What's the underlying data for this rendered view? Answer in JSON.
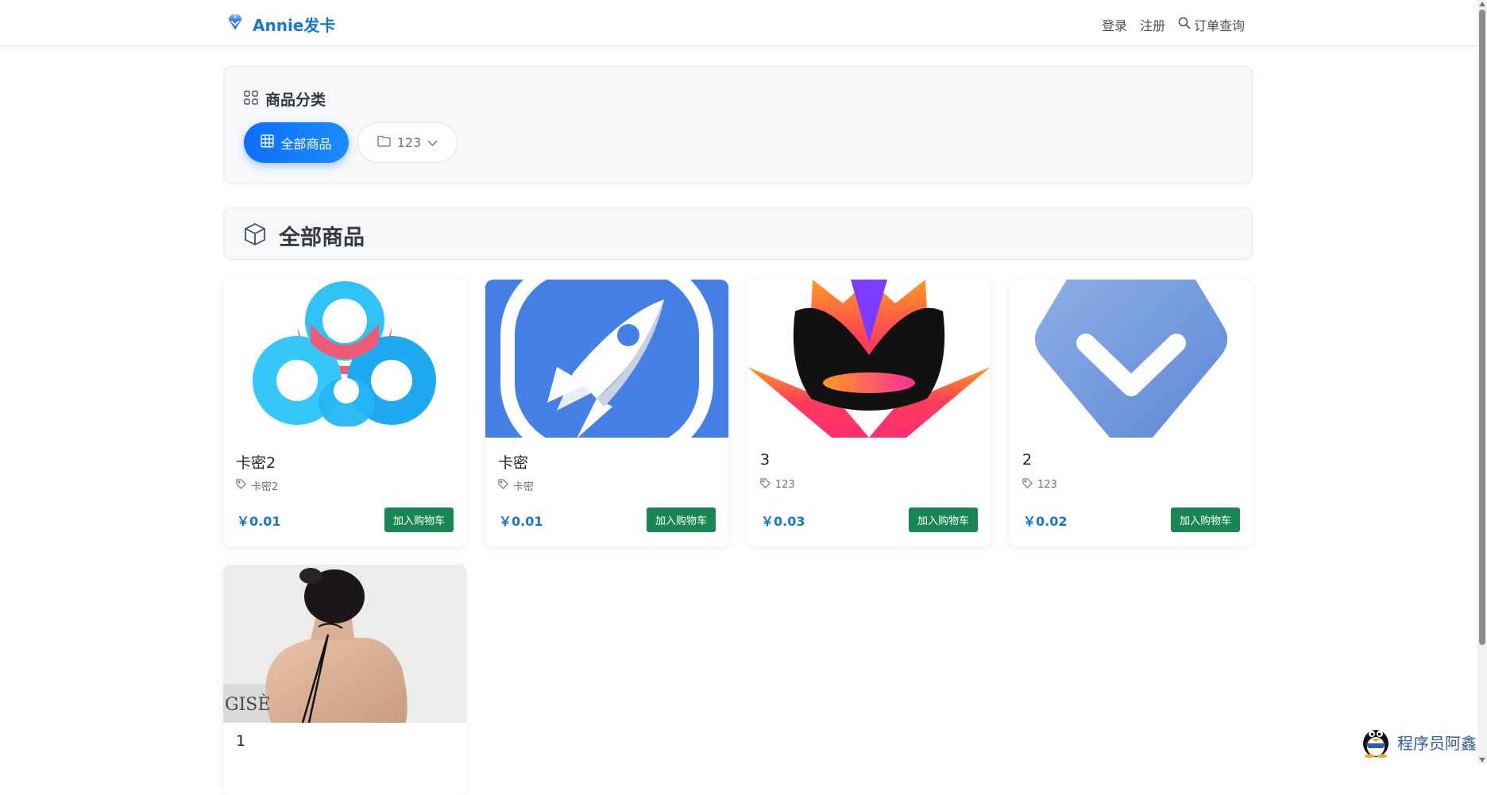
{
  "navbar": {
    "brand": "Annie发卡",
    "links": {
      "login": "登录",
      "register": "注册",
      "order_query": "订单查询"
    }
  },
  "categories": {
    "title": "商品分类",
    "all_label": "全部商品",
    "category_label": "123"
  },
  "section": {
    "title": "全部商品"
  },
  "products": [
    {
      "name": "卡密2",
      "tag": "卡密2",
      "price": "￥0.01",
      "button": "加入购物车",
      "image": "baidu-cloud-logo"
    },
    {
      "name": "卡密",
      "tag": "卡密",
      "price": "￥0.01",
      "button": "加入购物车",
      "image": "rocket-app-icon"
    },
    {
      "name": "3",
      "tag": "123",
      "price": "￥0.03",
      "button": "加入购物车",
      "image": "flame-crown-logo"
    },
    {
      "name": "2",
      "tag": "123",
      "price": "￥0.02",
      "button": "加入购物车",
      "image": "blue-gem-checkmark"
    },
    {
      "name": "1",
      "image": "woman-back-photo",
      "image_text": "GISÈ"
    }
  ],
  "watermark": {
    "text": "程序员阿鑫"
  },
  "colors": {
    "brand": "#1677d2",
    "primary": "#0d6efd",
    "success": "#198754",
    "panel_bg": "#f6f8fa"
  }
}
